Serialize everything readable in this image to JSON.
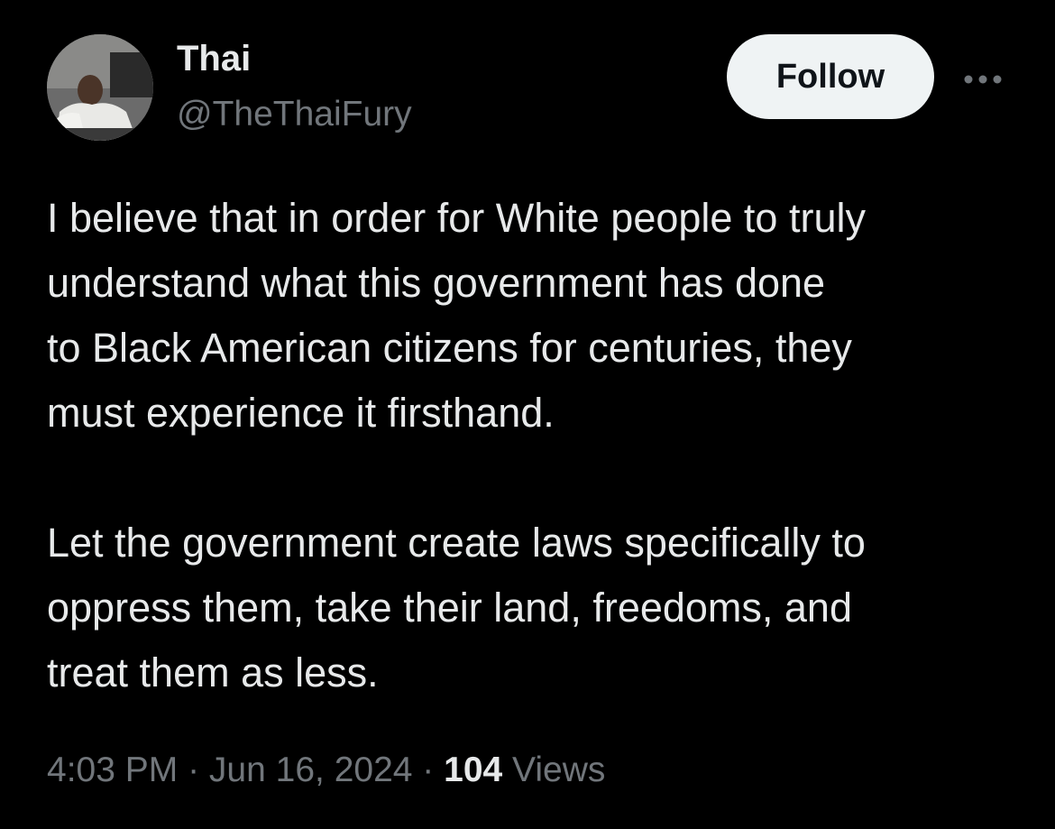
{
  "user": {
    "name": "Thai",
    "handle": "@TheThaiFury"
  },
  "actions": {
    "follow_label": "Follow",
    "more_icon": "ellipsis-icon"
  },
  "tweet": {
    "text": "I believe that in order for White people to truly\nunderstand what this government has done\nto Black American citizens for centuries, they\nmust experience it firsthand.\n\nLet the government create laws specifically to\noppress them, take their land, freedoms, and\ntreat them as less."
  },
  "meta": {
    "time": "4:03 PM",
    "separator": " · ",
    "date": "Jun 16, 2024",
    "views_count": "104",
    "views_label": " Views"
  },
  "colors": {
    "background": "#000000",
    "primary_text": "#e7e9ea",
    "secondary_text": "#71767b",
    "follow_button_bg": "#eff3f4",
    "follow_button_text": "#0f1419"
  }
}
